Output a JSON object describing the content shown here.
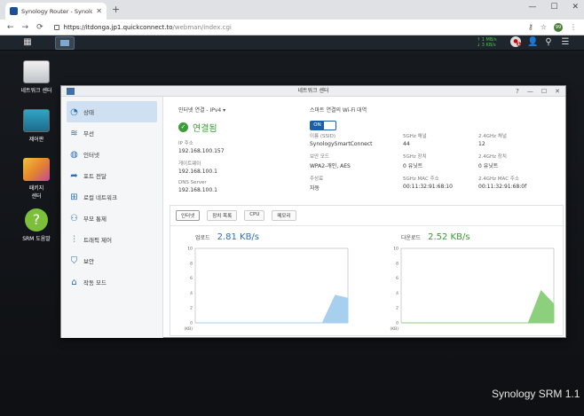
{
  "browser": {
    "tab_title": "Synology Router - SynologyRo...",
    "new_tab": "+",
    "url_host": "https://itdonga.jp1.quickconnect.to",
    "url_path": "/webman/index.cgi"
  },
  "taskbar": {
    "speed_up": "1 MB/s",
    "speed_down": "3 KB/s",
    "notif_count": "1"
  },
  "desktop": {
    "icons": [
      {
        "label": "네트워크 센터",
        "icon": "wifi-router-icon"
      },
      {
        "label": "제어판",
        "icon": "control-panel-icon"
      },
      {
        "label": "패키지\n센터",
        "icon": "package-icon"
      },
      {
        "label": "SRM 도움말",
        "icon": "help-icon"
      }
    ],
    "brand": "Synology SRM 1.1"
  },
  "window": {
    "title": "네트워크 센터",
    "sidebar": [
      {
        "label": "상태",
        "icon": "dashboard-icon",
        "active": true
      },
      {
        "label": "무선",
        "icon": "wifi-icon"
      },
      {
        "label": "인터넷",
        "icon": "globe-icon"
      },
      {
        "label": "포트 전달",
        "icon": "forward-icon"
      },
      {
        "label": "로컬 네트워크",
        "icon": "network-icon"
      },
      {
        "label": "부모 통제",
        "icon": "family-icon"
      },
      {
        "label": "트래픽 제어",
        "icon": "sliders-icon"
      },
      {
        "label": "보안",
        "icon": "shield-icon"
      },
      {
        "label": "작동 모드",
        "icon": "router-icon"
      }
    ],
    "internet": {
      "header": "인터넷 연결 - IPv4 ▾",
      "status": "연결됨",
      "ip_label": "IP 주소",
      "ip": "192.168.100.157",
      "gw_label": "게이트웨이",
      "gw": "192.168.100.1",
      "dns_label": "DNS Server",
      "dns": "192.168.100.1"
    },
    "wifi": {
      "header": "스마트 연결의 Wi-Fi 대역",
      "toggle": "ON",
      "ssid_label": "이름 (SSID)",
      "ssid": "SynologySmartConnect",
      "sec_label": "보안 모드",
      "sec": "WPA2-개인, AES",
      "mode_label": "주성료",
      "mode": "자동",
      "ch5_label": "5GHz 채널",
      "ch5": "44",
      "dev5_label": "5GHz 장치",
      "dev5": "0 유닛트",
      "mac5_label": "5GHz MAC 주소",
      "mac5": "00:11:32:91:68:10",
      "ch24_label": "2.4GHz 채널",
      "ch24": "12",
      "dev24_label": "2.4GHz 장치",
      "dev24": "0 유닛트",
      "mac24_label": "2.4GHz MAC 주소",
      "mac24": "00:11:32:91:68:0f"
    },
    "chart_tabs": [
      "인터넷",
      "장치 목록",
      "CPU",
      "메모리"
    ],
    "chart": {
      "upload_label": "업로드",
      "upload_speed": "2.81 KB/s",
      "download_label": "다운로드",
      "download_speed": "2.52 KB/s",
      "y_ticks": [
        "10",
        "8",
        "6",
        "4",
        "2",
        "0"
      ],
      "unit": "(KB)"
    }
  },
  "chart_data": [
    {
      "type": "area",
      "title": "업로드",
      "ylabel": "(KB)",
      "ylim": [
        0,
        10
      ],
      "series": [
        {
          "values": [
            0,
            0,
            0,
            0,
            0,
            0,
            0,
            0,
            0,
            0,
            0,
            3.7,
            3.3
          ]
        }
      ]
    },
    {
      "type": "area",
      "title": "다운로드",
      "ylabel": "(KB)",
      "ylim": [
        0,
        10
      ],
      "series": [
        {
          "values": [
            0,
            0,
            0,
            0,
            0,
            0,
            0,
            0,
            0,
            0,
            0,
            4.3,
            2.5
          ]
        }
      ]
    }
  ],
  "colors": {
    "upload": "#a7d0ef",
    "download": "#8ccf7d",
    "accent": "#2d6dbb"
  }
}
